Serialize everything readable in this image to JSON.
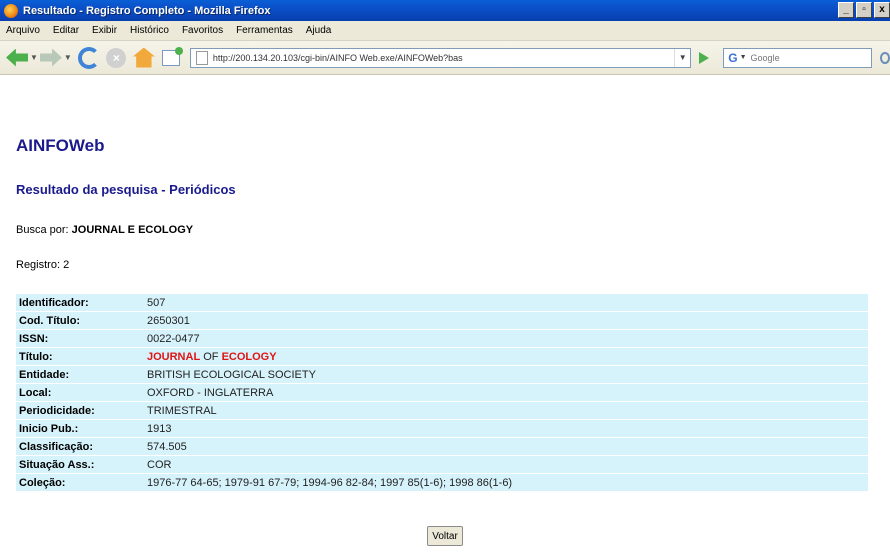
{
  "window": {
    "title": "Resultado - Registro Completo - Mozilla Firefox",
    "buttons": [
      "_",
      "▫",
      "x"
    ]
  },
  "menu": [
    "Arquivo",
    "Editar",
    "Exibir",
    "Histórico",
    "Favoritos",
    "Ferramentas",
    "Ajuda"
  ],
  "toolbar": {
    "url": "http://200.134.20.103/cgi-bin/AINFO Web.exe/AINFOWeb?bas",
    "search_placeholder": "Google"
  },
  "page": {
    "site_title": "AINFOWeb",
    "heading": "Resultado da pesquisa - Periódicos",
    "busca_label": "Busca por:",
    "busca_term": "JOURNAL E ECOLOGY",
    "registro": "Registro: 2",
    "fields": [
      {
        "label": "Identificador:",
        "value": "507"
      },
      {
        "label": "Cod. Título:",
        "value": "2650301"
      },
      {
        "label": "ISSN:",
        "value": "0022-0477"
      },
      {
        "label": "Título:",
        "value_parts": [
          "JOURNAL",
          " OF ",
          "ECOLOGY"
        ]
      },
      {
        "label": "Entidade:",
        "value": "BRITISH ECOLOGICAL SOCIETY"
      },
      {
        "label": "Local:",
        "value": "OXFORD - INGLATERRA"
      },
      {
        "label": "Periodicidade:",
        "value": "TRIMESTRAL"
      },
      {
        "label": "Inicio Pub.:",
        "value": "1913"
      },
      {
        "label": "Classificação:",
        "value": "574.505"
      },
      {
        "label": "Situação Ass.:",
        "value": "COR"
      },
      {
        "label": "Coleção:",
        "value": "1976-77 64-65; 1979-91 67-79; 1994-96 82-84; 1997 85(1-6); 1998 86(1-6)"
      }
    ],
    "back_button": "Voltar"
  }
}
